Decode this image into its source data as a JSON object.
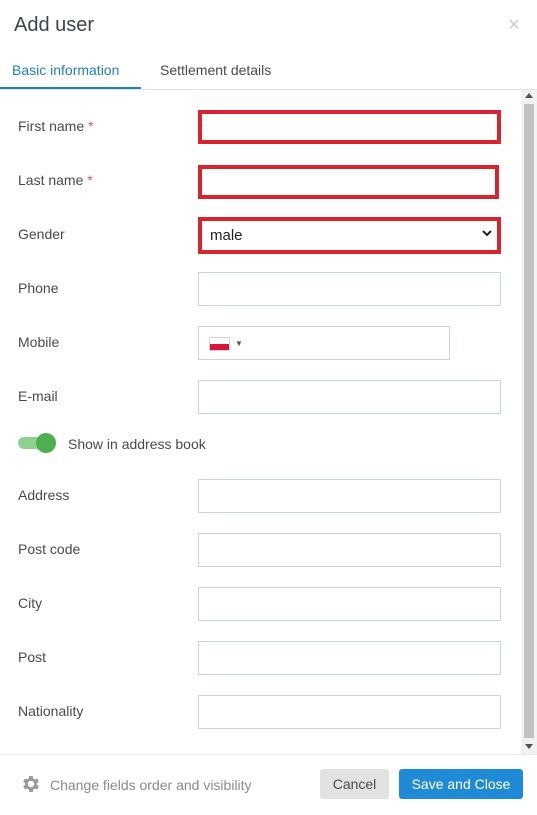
{
  "dialog": {
    "title": "Add user",
    "close_glyph": "×"
  },
  "tabs": [
    {
      "label": "Basic information",
      "active": true
    },
    {
      "label": "Settlement details",
      "active": false
    }
  ],
  "fields": {
    "first_name": {
      "label": "First name",
      "required": true,
      "value": ""
    },
    "last_name": {
      "label": "Last name",
      "required": true,
      "value": ""
    },
    "gender": {
      "label": "Gender",
      "value": "male"
    },
    "phone": {
      "label": "Phone",
      "value": ""
    },
    "mobile": {
      "label": "Mobile",
      "value": "",
      "country_flag": "poland-flag-icon"
    },
    "email": {
      "label": "E-mail",
      "value": ""
    },
    "address": {
      "label": "Address",
      "value": ""
    },
    "post_code": {
      "label": "Post code",
      "value": ""
    },
    "city": {
      "label": "City",
      "value": ""
    },
    "post": {
      "label": "Post",
      "value": ""
    },
    "nationality": {
      "label": "Nationality",
      "value": ""
    }
  },
  "required_marker": "*",
  "address_book_toggle": {
    "label": "Show in address book",
    "enabled": true
  },
  "footer": {
    "link": "Change fields order and visibility",
    "cancel": "Cancel",
    "save": "Save and Close"
  },
  "colors": {
    "accent": "#1f7fbf",
    "error_border": "#d9242f",
    "toggle_on": "#4caf50",
    "save_button": "#1f8ad6"
  }
}
